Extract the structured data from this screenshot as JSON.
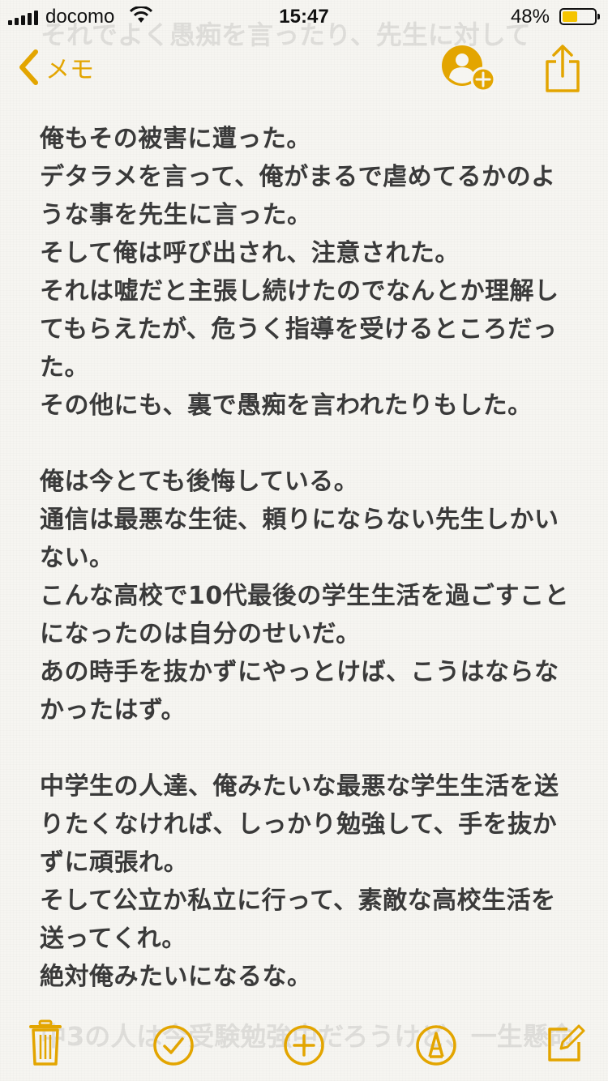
{
  "status_bar": {
    "carrier": "docomo",
    "time": "15:47",
    "battery_percent_label": "48%",
    "battery_level": 0.48
  },
  "nav": {
    "back_label": "メモ",
    "accent_color": "#e3a500"
  },
  "ghost_text": {
    "top": "それでよく愚痴を言ったり、先生に対して",
    "bottom": "中3の人は今受験勉強中だろうけど、一生懸命"
  },
  "note": {
    "lines": [
      "俺もその被害に遭った。",
      "デタラメを言って、俺がまるで虐めてるかのよ",
      "うな事を先生に言った。",
      "そして俺は呼び出され、注意された。",
      "それは嘘だと主張し続けたのでなんとか理解し",
      "てもらえたが、危うく指導を受けるところだっ",
      "た。",
      "その他にも、裏で愚痴を言われたりもした。",
      "",
      "俺は今とても後悔している。",
      "通信は最悪な生徒、頼りにならない先生しかい",
      "ない。",
      "こんな高校で10代最後の学生生活を過ごすこと",
      "になったのは自分のせいだ。",
      "あの時手を抜かずにやっとけば、こうはならな",
      "かったはず。",
      "",
      "中学生の人達、俺みたいな最悪な学生生活を送",
      "りたくなければ、しっかり勉強して、手を抜か",
      "ずに頑張れ。",
      "そして公立か私立に行って、素敵な高校生活を",
      "送ってくれ。",
      "絶対俺みたいになるな。"
    ]
  },
  "toolbar": {
    "icons": [
      "trash-icon",
      "checklist-icon",
      "add-icon",
      "markup-icon",
      "compose-icon"
    ]
  }
}
